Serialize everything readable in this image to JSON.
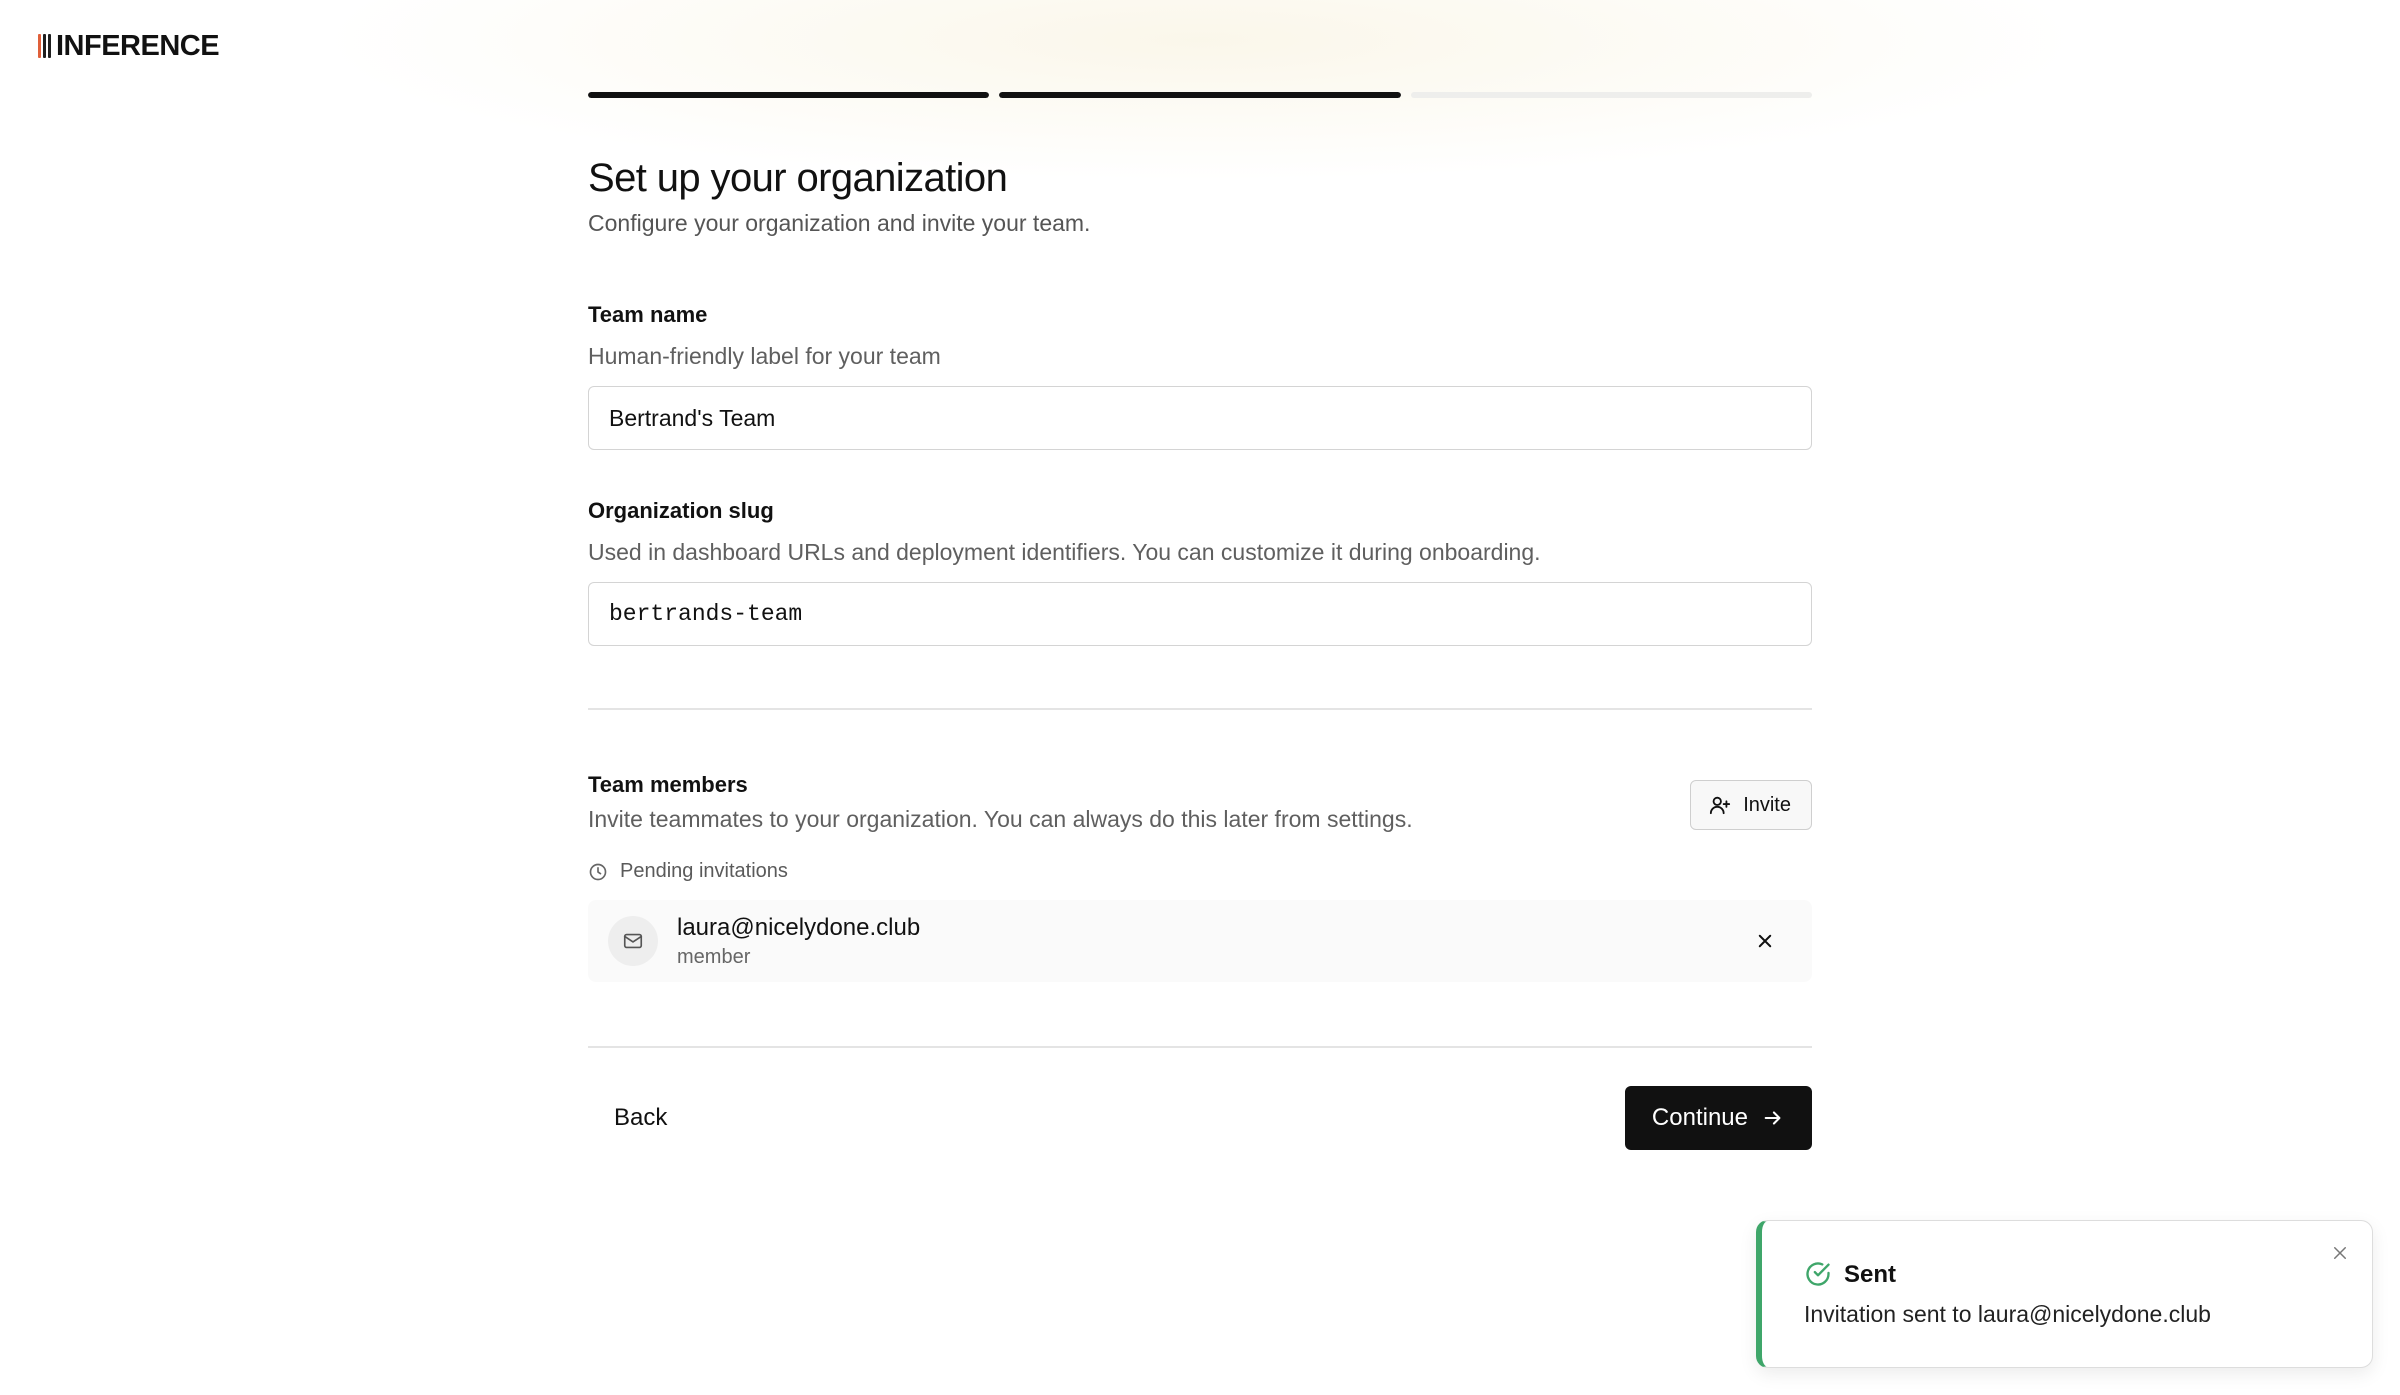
{
  "brand": {
    "name": "INFERENCE",
    "bar_colors": [
      "#e0603a",
      "#1f1f1f",
      "#1f1f1f"
    ]
  },
  "progress": {
    "steps_total": 3,
    "steps_complete": 2
  },
  "page": {
    "title": "Set up your organization",
    "subtitle": "Configure your organization and invite your team."
  },
  "team_name": {
    "label": "Team name",
    "help": "Human-friendly label for your team",
    "value": "Bertrand's Team"
  },
  "org_slug": {
    "label": "Organization slug",
    "help": "Used in dashboard URLs and deployment identifiers. You can customize it during onboarding.",
    "value": "bertrands-team"
  },
  "team_members": {
    "label": "Team members",
    "help": "Invite teammates to your organization. You can always do this later from settings.",
    "invite_button": "Invite",
    "pending_label": "Pending invitations",
    "invitations": [
      {
        "email": "laura@nicelydone.club",
        "role": "member"
      }
    ]
  },
  "footer": {
    "back_label": "Back",
    "continue_label": "Continue"
  },
  "toast": {
    "title": "Sent",
    "message": "Invitation sent to laura@nicelydone.club",
    "accent_color": "#3fa66a"
  },
  "icons": {
    "logo": "bars-logo-icon",
    "invite": "user-plus-icon",
    "pending": "clock-icon",
    "invitation_avatar": "mail-icon",
    "remove": "close-icon",
    "continue": "arrow-right-icon",
    "toast_status": "check-circle-icon",
    "toast_close": "close-icon"
  }
}
